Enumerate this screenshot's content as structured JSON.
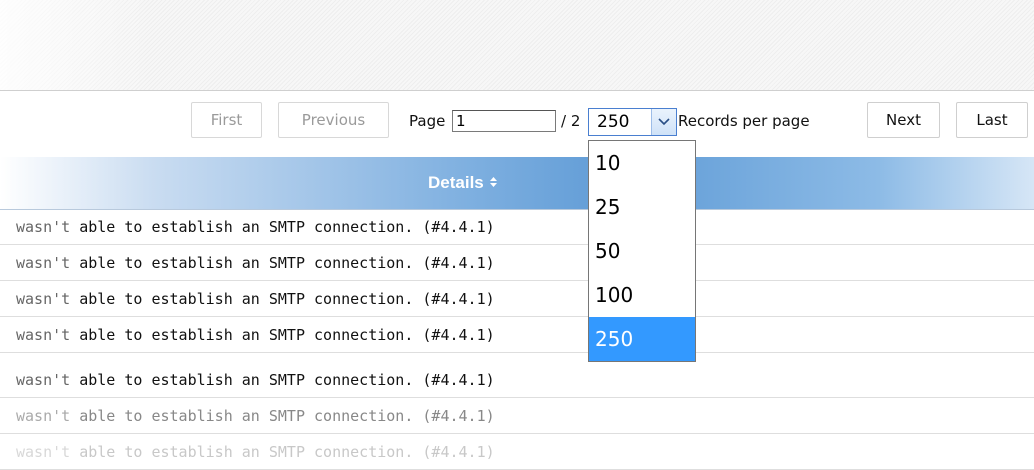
{
  "pager": {
    "first": "First",
    "previous": "Previous",
    "page_label": "Page",
    "page_value": "1",
    "total_label": "/ 2",
    "records_per_page": {
      "selected": "250",
      "options": [
        "10",
        "25",
        "50",
        "100",
        "250"
      ]
    },
    "rpp_label": "Records per page",
    "next": "Next",
    "last": "Last"
  },
  "table": {
    "header": "Details",
    "rows": [
      {
        "pre": "wasn't",
        "text": " able to establish an SMTP connection. (#4.4.1)"
      },
      {
        "pre": "wasn't",
        "text": " able to establish an SMTP connection. (#4.4.1)"
      },
      {
        "pre": "wasn't",
        "text": " able to establish an SMTP connection. (#4.4.1)"
      },
      {
        "pre": "wasn't",
        "text": " able to establish an SMTP connection. (#4.4.1)"
      },
      {
        "pre": "wasn't",
        "text": " able to establish an SMTP connection. (#4.4.1)"
      },
      {
        "pre": "wasn't",
        "text": " able to establish an SMTP connection. (#4.4.1)"
      },
      {
        "pre": "wasn't",
        "text": " able to establish an SMTP connection. (#4.4.1)"
      }
    ]
  },
  "colors": {
    "select_border": "#4a7fd0",
    "highlight": "#3399ff",
    "header_blue": "#5f9bd6"
  }
}
